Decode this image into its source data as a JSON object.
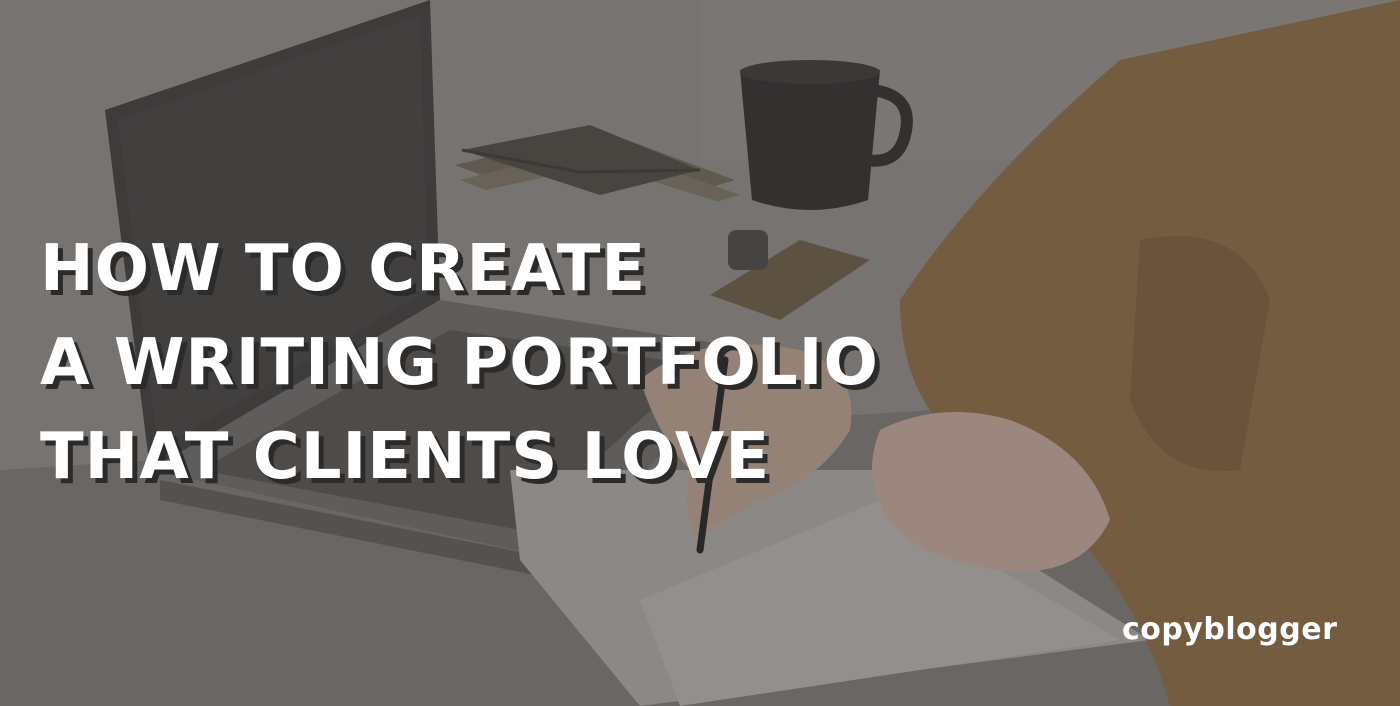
{
  "headline": {
    "line1": "HOW TO CREATE",
    "line2": "A WRITING PORTFOLIO",
    "line3": "THAT CLIENTS LOVE"
  },
  "brand": {
    "name": "copyblogger"
  },
  "colors": {
    "headline_text": "#ffffff",
    "headline_shadow": "#2c2b2a",
    "brand_text": "#ffffff",
    "sweater": "#8a6a45"
  },
  "image_subject": {
    "elements": [
      "laptop-icon",
      "mug-icon",
      "notebook-icon",
      "envelope-icon",
      "pen-icon",
      "hand-icon",
      "clipboard-icon"
    ]
  }
}
